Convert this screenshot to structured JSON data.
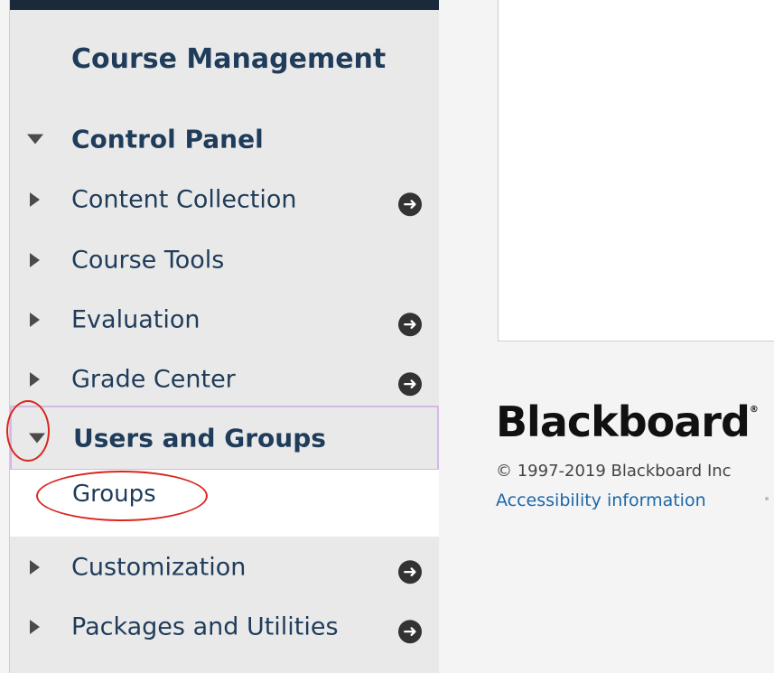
{
  "sidebar": {
    "title": "Course Management",
    "control_panel": "Control Panel",
    "items": [
      {
        "label": "Content Collection",
        "has_arrow": true
      },
      {
        "label": "Course Tools",
        "has_arrow": false
      },
      {
        "label": "Evaluation",
        "has_arrow": true
      },
      {
        "label": "Grade Center",
        "has_arrow": true
      },
      {
        "label": "Users and Groups",
        "has_arrow": false,
        "expanded": true
      },
      {
        "label": "Customization",
        "has_arrow": true
      },
      {
        "label": "Packages and Utilities",
        "has_arrow": true
      }
    ],
    "subitem": "Groups",
    "arrow_glyph": "➜"
  },
  "footer": {
    "brand": "Blackboard",
    "brand_mark": "®",
    "copyright": "© 1997-2019 Blackboard Inc",
    "accessibility": "Accessibility information"
  },
  "colors": {
    "accent": "#1f3c5a",
    "highlight_border": "#d7b8e3",
    "annotation_red": "#d9261c",
    "link": "#1d67a8"
  }
}
